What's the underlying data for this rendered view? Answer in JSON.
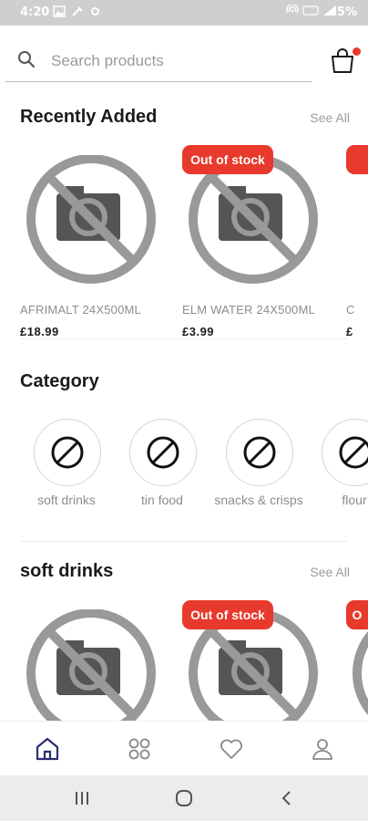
{
  "status_bar": {
    "time": "4:20",
    "battery": "5%"
  },
  "search": {
    "placeholder": "Search products"
  },
  "recently_added": {
    "title": "Recently Added",
    "see_all": "See All",
    "products": [
      {
        "name": "AFRIMALT 24X500ML",
        "price": "£18.99",
        "out_of_stock": false
      },
      {
        "name": "ELM WATER 24X500ML",
        "price": "£3.99",
        "out_of_stock": true,
        "badge": "Out of stock"
      },
      {
        "name": "C",
        "price": "£",
        "out_of_stock": true,
        "badge": ""
      }
    ]
  },
  "category": {
    "title": "Category",
    "items": [
      {
        "label": "soft drinks"
      },
      {
        "label": "tin food"
      },
      {
        "label": "snacks & crisps"
      },
      {
        "label": "flour"
      }
    ]
  },
  "soft_drinks": {
    "title": "soft drinks",
    "see_all": "See All",
    "products": [
      {
        "out_of_stock": false
      },
      {
        "out_of_stock": true,
        "badge": "Out of stock"
      },
      {
        "out_of_stock": true,
        "badge": "O"
      }
    ]
  },
  "bottom_nav": [
    "home-icon",
    "grid-icon",
    "heart-icon",
    "profile-icon"
  ],
  "colors": {
    "badge": "#e8392d",
    "nav_active": "#2b2f6e",
    "cart_dot": "#e83a2f"
  }
}
